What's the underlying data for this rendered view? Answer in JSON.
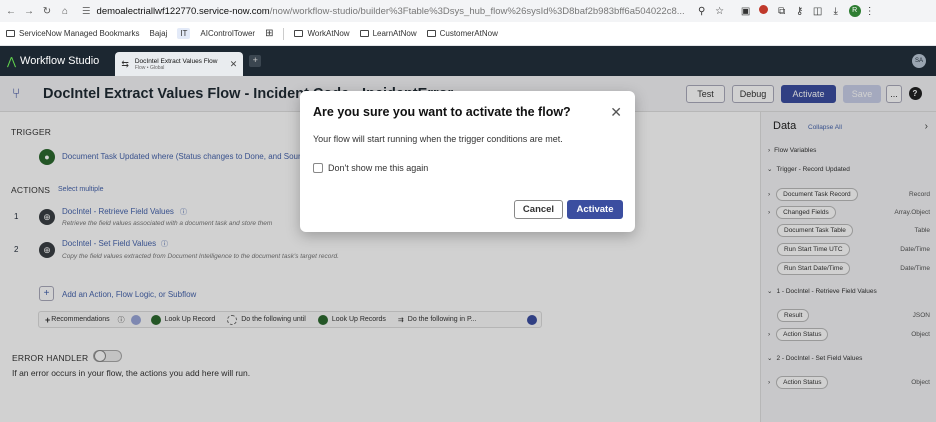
{
  "browser": {
    "url_host": "demoalectriallwf122770.service-now.com",
    "url_path": "/now/workflow-studio/builder%3Ftable%3Dsys_hub_flow%26sysId%3D8baf2b983bff6a504022c8...",
    "profile_initial": "R",
    "bookmarks": [
      "ServiceNow Managed Bookmarks",
      "Bajaj",
      "IT",
      "AIControlTower",
      "WorkAtNow",
      "LearnAtNow",
      "CustomerAtNow"
    ]
  },
  "app": {
    "name": "Workflow Studio",
    "tab_title": "DocIntel Extract Values Flow",
    "tab_subtitle": "Flow • Global",
    "avatar": "SA"
  },
  "toolbar": {
    "flow_title": "DocIntel Extract Values Flow - Incident Code - IncidentError",
    "test": "Test",
    "debug": "Debug",
    "activate": "Activate",
    "save": "Save",
    "more": "...",
    "help": "?"
  },
  "flow": {
    "trigger_label": "TRIGGER",
    "trigger_text": "Document Task Updated where (Status changes to Done, and Source",
    "actions_label": "ACTIONS",
    "select_multiple": "Select multiple",
    "actions": [
      {
        "num": "1",
        "title": "DocIntel - Retrieve Field Values",
        "desc": "Retrieve the field values associated with a document task and store them"
      },
      {
        "num": "2",
        "title": "DocIntel - Set Field Values",
        "desc": "Copy the field values extracted from Document Intelligence to the document task's target record."
      }
    ],
    "add_action": "Add an Action, Flow Logic, or Subflow",
    "recommendations": "Recommendations",
    "recs": [
      "Look Up Record",
      "Do the following until",
      "Look Up Records",
      "Do the following in P..."
    ],
    "error_handler": "ERROR HANDLER",
    "error_text": "If an error occurs in your flow, the actions you add here will run."
  },
  "data_panel": {
    "title": "Data",
    "collapse_all": "Collapse All",
    "flow_variables": "Flow Variables",
    "trigger_section": "Trigger - Record Updated",
    "trigger_items": [
      {
        "name": "Document Task Record",
        "type": "Record",
        "expand": true
      },
      {
        "name": "Changed Fields",
        "type": "Array.Object",
        "expand": true
      },
      {
        "name": "Document Task Table",
        "type": "Table",
        "expand": false
      },
      {
        "name": "Run Start Time UTC",
        "type": "Date/Time",
        "expand": false
      },
      {
        "name": "Run Start Date/Time",
        "type": "Date/Time",
        "expand": false
      }
    ],
    "section1": "1 - DocIntel - Retrieve Field Values",
    "section1_items": [
      {
        "name": "Result",
        "type": "JSON",
        "expand": false
      },
      {
        "name": "Action Status",
        "type": "Object",
        "expand": true
      }
    ],
    "section2": "2 - DocIntel - Set Field Values",
    "section2_items": [
      {
        "name": "Action Status",
        "type": "Object",
        "expand": true
      }
    ]
  },
  "modal": {
    "title": "Are you sure you want to activate the flow?",
    "body": "Your flow will start running when the trigger conditions are met.",
    "checkbox": "Don't show me this again",
    "cancel": "Cancel",
    "activate": "Activate"
  },
  "colors": {
    "primary": "#3b4ea0",
    "header": "#1c2731",
    "accent_green": "#62d84e"
  }
}
